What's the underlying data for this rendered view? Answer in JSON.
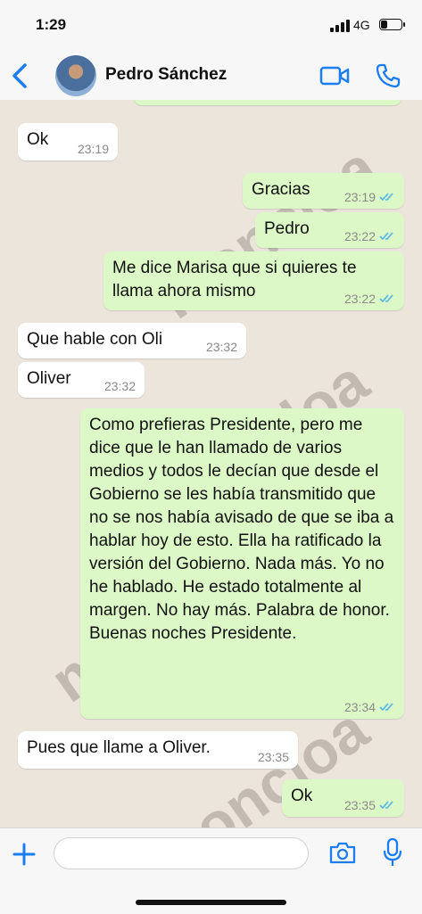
{
  "status": {
    "time": "1:29",
    "network": "4G"
  },
  "header": {
    "contact_name": "Pedro Sánchez"
  },
  "messages": [
    {
      "dir": "in",
      "text": "Ok",
      "time": "23:19"
    },
    {
      "dir": "out",
      "text": "Gracias",
      "time": "23:19"
    },
    {
      "dir": "out",
      "text": "Pedro",
      "time": "23:22"
    },
    {
      "dir": "out",
      "text": "Me dice Marisa que si quieres te llama ahora mismo",
      "time": "23:22"
    },
    {
      "dir": "in",
      "text": "Que hable con Oli",
      "time": "23:32"
    },
    {
      "dir": "in",
      "text": "Oliver",
      "time": "23:32"
    },
    {
      "dir": "out",
      "text": "Como prefieras Presidente, pero me dice que le han llamado de varios medios y todos le decían que desde el Gobierno se les había transmitido que no se nos había avisado de que se iba a hablar hoy de esto. Ella ha ratificado la versión del Gobierno. Nada más. Yo no he hablado. He estado totalmente al margen. No hay más. Palabra de honor.\nBuenas noches Presidente.",
      "time": "23:34"
    },
    {
      "dir": "in",
      "text": "Pues que llame a Oliver.",
      "time": "23:35"
    },
    {
      "dir": "out",
      "text": "Ok",
      "time": "23:35"
    }
  ],
  "watermark": "moncloa",
  "colors": {
    "accent": "#1a7ef2",
    "outgoing": "#dcf8c6",
    "incoming": "#ffffff",
    "ticks": "#4fb6ec"
  }
}
